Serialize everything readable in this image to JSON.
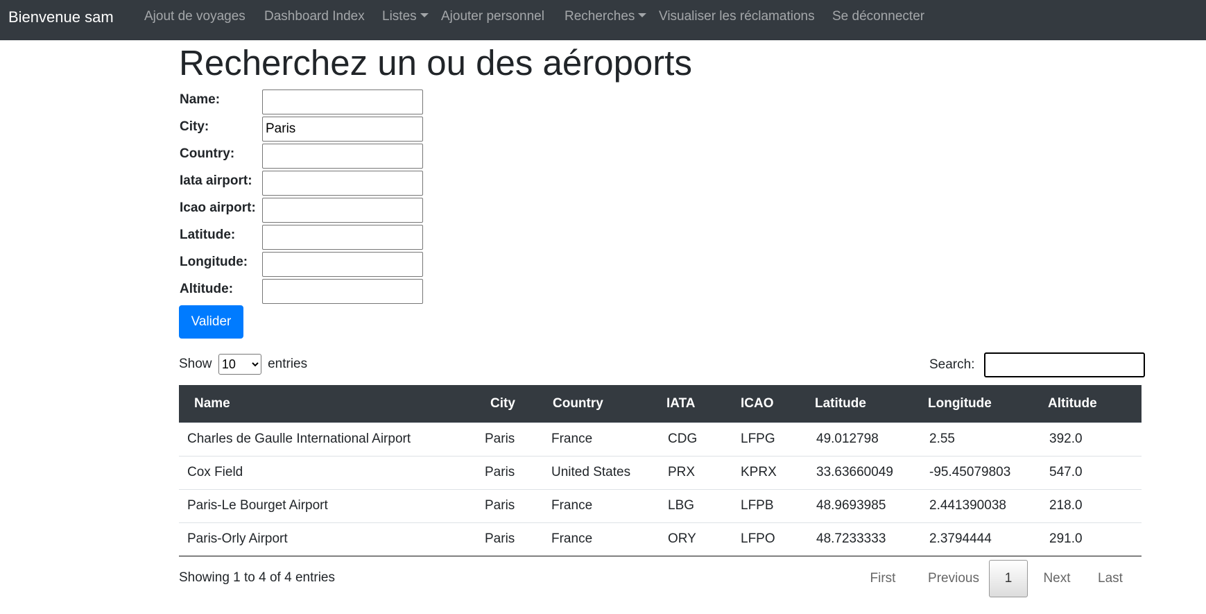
{
  "navbar": {
    "brand": "Bienvenue sam",
    "links": [
      {
        "label": "Ajout de voyages"
      },
      {
        "label": "Dashboard Index"
      },
      {
        "label": "Listes"
      },
      {
        "label": "Ajouter personnel"
      },
      {
        "label": "Recherches"
      },
      {
        "label": "Visualiser les réclamations"
      },
      {
        "label": "Se déconnecter"
      }
    ]
  },
  "page": {
    "title": "Recherchez un ou des aéroports"
  },
  "form": {
    "fields": [
      {
        "label": "Name:",
        "value": ""
      },
      {
        "label": "City:",
        "value": "Paris"
      },
      {
        "label": "Country:",
        "value": ""
      },
      {
        "label": "Iata airport:",
        "value": ""
      },
      {
        "label": "Icao airport:",
        "value": ""
      },
      {
        "label": "Latitude:",
        "value": ""
      },
      {
        "label": "Longitude:",
        "value": ""
      },
      {
        "label": "Altitude:",
        "value": ""
      }
    ],
    "submit_label": "Valider"
  },
  "datatable": {
    "show_label": "Show",
    "entries_label": "entries",
    "page_length": "10",
    "search_label": "Search:",
    "search_value": "",
    "columns": [
      "Name",
      "City",
      "Country",
      "IATA",
      "ICAO",
      "Latitude",
      "Longitude",
      "Altitude"
    ],
    "rows": [
      [
        "Charles de Gaulle International Airport",
        "Paris",
        "France",
        "CDG",
        "LFPG",
        "49.012798",
        "2.55",
        "392.0"
      ],
      [
        "Cox Field",
        "Paris",
        "United States",
        "PRX",
        "KPRX",
        "33.63660049",
        "-95.45079803",
        "547.0"
      ],
      [
        "Paris-Le Bourget Airport",
        "Paris",
        "France",
        "LBG",
        "LFPB",
        "48.9693985",
        "2.441390038",
        "218.0"
      ],
      [
        "Paris-Orly Airport",
        "Paris",
        "France",
        "ORY",
        "LFPO",
        "48.7233333",
        "2.3794444",
        "291.0"
      ]
    ],
    "info": "Showing 1 to 4 of 4 entries",
    "pagination": {
      "first": "First",
      "previous": "Previous",
      "current": "1",
      "next": "Next",
      "last": "Last"
    }
  }
}
